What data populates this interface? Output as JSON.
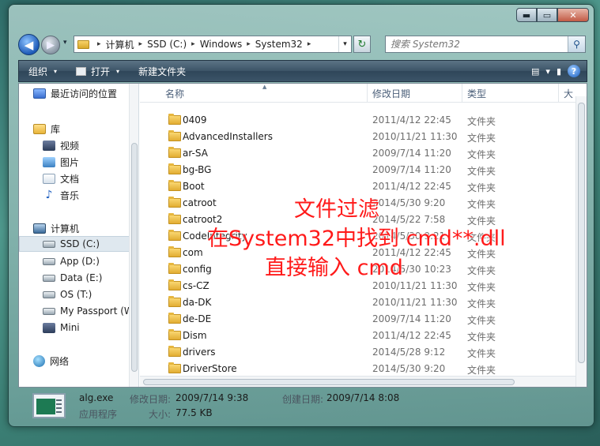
{
  "window": {
    "caption_buttons": {
      "minimize": "▬",
      "maximize": "▭",
      "close": "✕"
    }
  },
  "navigation": {
    "back_symbol": "◀",
    "forward_symbol": "▶",
    "history_symbol": "▾",
    "address_segments": [
      "计算机",
      "SSD (C:)",
      "Windows",
      "System32"
    ],
    "address_sep": "▸",
    "address_drop": "▾",
    "refresh_symbol": "↻",
    "search_placeholder": "搜索 System32",
    "search_symbol": "⚲"
  },
  "toolbar": {
    "organize_label": "组织",
    "open_label": "打开",
    "new_folder_label": "新建文件夹",
    "caret": "▾",
    "view_symbol": "▤",
    "preview_symbol": "▮",
    "help_symbol": "?"
  },
  "sidebar": {
    "items": [
      {
        "label": "最近访问的位置",
        "icon": "recent-places-icon"
      },
      {
        "label": "库",
        "icon": "library-icon"
      },
      {
        "label": "视频",
        "icon": "video-icon"
      },
      {
        "label": "图片",
        "icon": "pictures-icon"
      },
      {
        "label": "文档",
        "icon": "documents-icon"
      },
      {
        "label": "音乐",
        "icon": "music-icon"
      },
      {
        "label": "计算机",
        "icon": "computer-icon"
      },
      {
        "label": "SSD (C:)",
        "icon": "drive-icon",
        "selected": true
      },
      {
        "label": "App (D:)",
        "icon": "drive-icon"
      },
      {
        "label": "Data (E:)",
        "icon": "drive-icon"
      },
      {
        "label": "OS (T:)",
        "icon": "drive-icon"
      },
      {
        "label": "My Passport (W:)",
        "icon": "drive-icon"
      },
      {
        "label": "Mini",
        "icon": "device-icon"
      },
      {
        "label": "网络",
        "icon": "network-icon"
      }
    ]
  },
  "columns": {
    "name": "名称",
    "date": "修改日期",
    "type": "类型",
    "size": "大"
  },
  "files": [
    {
      "name": "0409",
      "date": "2011/4/12 22:45",
      "type": "文件夹"
    },
    {
      "name": "AdvancedInstallers",
      "date": "2010/11/21 11:30",
      "type": "文件夹"
    },
    {
      "name": "ar-SA",
      "date": "2009/7/14 11:20",
      "type": "文件夹"
    },
    {
      "name": "bg-BG",
      "date": "2009/7/14 11:20",
      "type": "文件夹"
    },
    {
      "name": "Boot",
      "date": "2011/4/12 22:45",
      "type": "文件夹"
    },
    {
      "name": "catroot",
      "date": "2014/5/30 9:20",
      "type": "文件夹"
    },
    {
      "name": "catroot2",
      "date": "2014/5/22 7:58",
      "type": "文件夹"
    },
    {
      "name": "CodeIntegrity",
      "date": "2014/5/30 9:21",
      "type": "文件夹"
    },
    {
      "name": "com",
      "date": "2011/4/12 22:45",
      "type": "文件夹"
    },
    {
      "name": "config",
      "date": "2014/5/30 10:23",
      "type": "文件夹"
    },
    {
      "name": "cs-CZ",
      "date": "2010/11/21 11:30",
      "type": "文件夹"
    },
    {
      "name": "da-DK",
      "date": "2010/11/21 11:30",
      "type": "文件夹"
    },
    {
      "name": "de-DE",
      "date": "2009/7/14 11:20",
      "type": "文件夹"
    },
    {
      "name": "Dism",
      "date": "2011/4/12 22:45",
      "type": "文件夹"
    },
    {
      "name": "drivers",
      "date": "2014/5/28 9:12",
      "type": "文件夹"
    },
    {
      "name": "DriverStore",
      "date": "2014/5/30 9:20",
      "type": "文件夹"
    }
  ],
  "overlay": {
    "line1": "文件过滤",
    "line2": "在System32中找到 cmd**.dll",
    "line3": "直接输入 cmd",
    "color": "#ff1a1a"
  },
  "details": {
    "filename": "alg.exe",
    "file_type": "应用程序",
    "modified_label": "修改日期:",
    "modified_value": "2009/7/14 9:38",
    "created_label": "创建日期:",
    "created_value": "2009/7/14 8:08",
    "size_label": "大小:",
    "size_value": "77.5 KB"
  }
}
